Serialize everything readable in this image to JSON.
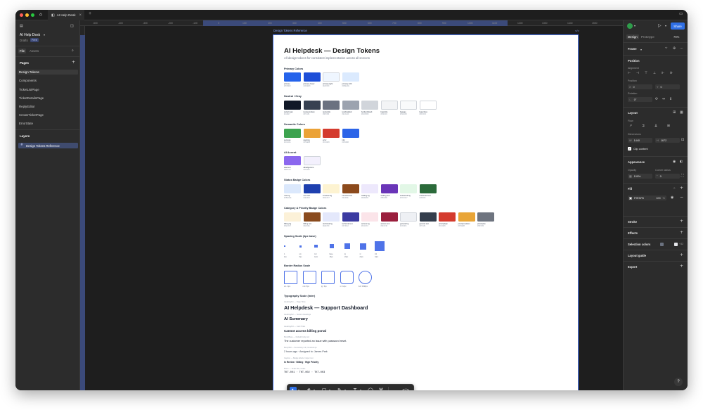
{
  "window": {
    "tab_title": "AI Help Desk",
    "close_glyph": "×",
    "new_tab_glyph": "+"
  },
  "left_panel": {
    "file_name": "AI Help Desk",
    "drafts": "Drafts",
    "plan_badge": "Free",
    "tabs": [
      "File",
      "Assets"
    ],
    "pages_heading": "Pages",
    "pages": [
      "Design Tokens",
      "Components",
      "TicketListPage",
      "TicketDetailsPage",
      "ReplyEditor",
      "CreateTicketPage",
      "ErrorState"
    ],
    "layers_heading": "Layers",
    "layers": [
      "Design Tokens Reference"
    ]
  },
  "rulers": {
    "top_ticks": [
      "-500",
      "-400",
      "-300",
      "-200",
      "-100",
      "0",
      "100",
      "200",
      "300",
      "400",
      "500",
      "600",
      "700",
      "800",
      "900",
      "1000",
      "1100",
      "1200",
      "1300",
      "1440",
      "1500",
      "1600",
      "1700",
      "1800",
      "1900"
    ]
  },
  "frame": {
    "label": "Design Tokens Reference",
    "code_glyph": "</>"
  },
  "doc": {
    "title": "AI Helpdesk — Design Tokens",
    "subtitle": "All design tokens for consistent implementation across all screens",
    "sections": {
      "primary": "Primary Colors",
      "neutral": "Neutral / Gray",
      "semantic": "Semantic Colors",
      "ai": "AI Accent",
      "status": "Status Badge Colors",
      "category": "Category & Priority Badge Colors",
      "spacing": "Spacing Scale (4px base)",
      "radius": "Border Radius Scale",
      "typography": "Typography Scale (Inter)"
    },
    "primary_colors": [
      {
        "name": "primary",
        "hex": "#2563EB",
        "color": "#2563eb"
      },
      {
        "name": "primary-hover",
        "hex": "#1D4ED8",
        "color": "#1d4ed8"
      },
      {
        "name": "primary-light",
        "hex": "#EFF6FF",
        "color": "#eff6ff"
      },
      {
        "name": "primary-100",
        "hex": "#DBEAFE",
        "color": "#dbeafe"
      }
    ],
    "neutral_colors": [
      {
        "name": "textprimary",
        "hex": "#111827",
        "color": "#111827"
      },
      {
        "name": "textsecondary",
        "hex": "#374151",
        "color": "#374151"
      },
      {
        "name": "textsubtle",
        "hex": "#6B7280",
        "color": "#6b7280"
      },
      {
        "name": "textdisabled",
        "hex": "#9CA3AF",
        "color": "#9ca3af"
      },
      {
        "name": "borderdefault",
        "hex": "#D1D5DB",
        "color": "#d1d5db"
      },
      {
        "name": "bgsubtle",
        "hex": "#F3F4F6",
        "color": "#f3f4f6"
      },
      {
        "name": "bgpage",
        "hex": "#F9FAFB",
        "color": "#f9fafb"
      },
      {
        "name": "bgsurface",
        "hex": "#FFFFFF",
        "color": "#ffffff"
      }
    ],
    "semantic_colors": [
      {
        "name": "success",
        "hex": "#16A34A",
        "color": "#3da34f"
      },
      {
        "name": "warning",
        "hex": "#F59E0B",
        "color": "#eba237"
      },
      {
        "name": "error",
        "hex": "#DC2626",
        "color": "#d43b2e"
      },
      {
        "name": "info",
        "hex": "#2563EB",
        "color": "#2b64e8"
      }
    ],
    "ai_colors": [
      {
        "name": "aiaccent",
        "hex": "#8B5CF6",
        "color": "#8b67ee"
      },
      {
        "name": "aibadgenone",
        "hex": "#F5F3FF",
        "color": "#f3f0fd"
      }
    ],
    "status_colors": [
      {
        "name": "new bg",
        "hex": "#DBEAFE",
        "color": "#dbe8fc"
      },
      {
        "name": "new text",
        "hex": "#1E40AF",
        "color": "#1e40af"
      },
      {
        "name": "inreview bg",
        "hex": "#FEF3C7",
        "color": "#fdf3d1"
      },
      {
        "name": "inreview text",
        "hex": "#92400E",
        "color": "#8c4a1c"
      },
      {
        "name": "waiting bg",
        "hex": "#EDE9FE",
        "color": "#ede8fc"
      },
      {
        "name": "waiting text",
        "hex": "#5B21B6",
        "color": "#6a35b8"
      },
      {
        "name": "answered bg",
        "hex": "#DCFCE7",
        "color": "#e2f7e6"
      },
      {
        "name": "answered text",
        "hex": "#166534",
        "color": "#2b6a3a"
      }
    ],
    "category_colors": [
      {
        "name": "billing bg",
        "hex": "#FEF3C7",
        "color": "#fcf1d8"
      },
      {
        "name": "billing text",
        "hex": "#92400E",
        "color": "#8a4b1e"
      },
      {
        "name": "technical bg",
        "hex": "#E0E7FF",
        "color": "#e4e8fb"
      },
      {
        "name": "technical text",
        "hex": "#3730A3",
        "color": "#3b3aa1"
      },
      {
        "name": "access bg",
        "hex": "#FCE7F3",
        "color": "#fbe4e9"
      },
      {
        "name": "access text",
        "hex": "#9D174D",
        "color": "#9a1f3d"
      },
      {
        "name": "general bg",
        "hex": "#F3F4F6",
        "color": "#eef0f4"
      },
      {
        "name": "general text",
        "hex": "#374151",
        "color": "#343e4c"
      },
      {
        "name": "priorityhigh",
        "hex": "#DC2626",
        "color": "#d43b2e"
      },
      {
        "name": "prioritymedium",
        "hex": "#F59E0B",
        "color": "#e9a537"
      },
      {
        "name": "prioritylow",
        "hex": "#6B7280",
        "color": "#6e747f"
      }
    ],
    "spacing": [
      {
        "name": "1",
        "value": "4px"
      },
      {
        "name": "sm",
        "value": "8px"
      },
      {
        "name": "md",
        "value": "12px"
      },
      {
        "name": "base",
        "value": "16px"
      },
      {
        "name": "lg",
        "value": "20px"
      },
      {
        "name": "xl",
        "value": "24px"
      },
      {
        "name": "2xl",
        "value": "32px"
      }
    ],
    "radius": [
      {
        "label": "sm / 4px"
      },
      {
        "label": "md / 8px"
      },
      {
        "label": "lg / 6px"
      },
      {
        "label": "xl / 12px"
      },
      {
        "label": "full / 9999px"
      }
    ],
    "typography": [
      {
        "meta": "Heading/H1 — Page Titles",
        "sample": "AI Helpdesk — Support Dashboard"
      },
      {
        "meta": "Heading/H2 — Section Headings",
        "sample": "AI Summary"
      },
      {
        "meta": "Heading/H3 — Card Titles",
        "sample": "Cannot access billing portal"
      },
      {
        "meta": "Body/Base — Default body text",
        "sample": "The customer reported an issue with password reset."
      },
      {
        "meta": "Body/SM — Secondary info, timestamps",
        "sample": "2 hours ago · Assigned to: James Park"
      },
      {
        "meta": "Caption — Badge labels, helper text",
        "sample": "In Review · Billing · High Priority"
      },
      {
        "meta": "Mono — Ticket IDs, codes",
        "sample": "TKT-001 · TKT-002 · TKT-003"
      }
    ]
  },
  "right_panel": {
    "tabs": [
      "Design",
      "Prototype"
    ],
    "zoom": "75%",
    "share_label": "Share",
    "frame_label": "Frame",
    "position_heading": "Position",
    "alignment_label": "Alignment",
    "position_label": "Position",
    "x_label": "X",
    "x_value": "0",
    "y_label": "Y",
    "y_value": "0",
    "rotation_label": "Rotation",
    "rotation_value": "0°",
    "layout_heading": "Layout",
    "flow_label": "Flow",
    "dimensions_label": "Dimensions",
    "w_label": "W",
    "w_value": "1440",
    "h_label": "H",
    "h_value": "1672",
    "clip_content_label": "Clip content",
    "appearance_heading": "Appearance",
    "opacity_label": "Opacity",
    "opacity_value": "100%",
    "corner_radius_label": "Corner radius",
    "corner_radius_value": "0",
    "fill_heading": "Fill",
    "fill_hex": "F9FAFB",
    "fill_opacity": "100",
    "fill_percent": "%",
    "stroke_heading": "Stroke",
    "effects_heading": "Effects",
    "selection_colors_heading": "Selection colors",
    "selection_more": "+32",
    "layout_guide_heading": "Layout guide",
    "export_heading": "Export",
    "help_label": "?"
  },
  "toolbar": {
    "move_tool": "↖",
    "frame_tool": "#",
    "shape_tool": "□",
    "pen_tool": "✎",
    "text_tool": "T",
    "comment_tool": "◯",
    "actions_tool": "⌘",
    "dev_mode": "</>"
  }
}
